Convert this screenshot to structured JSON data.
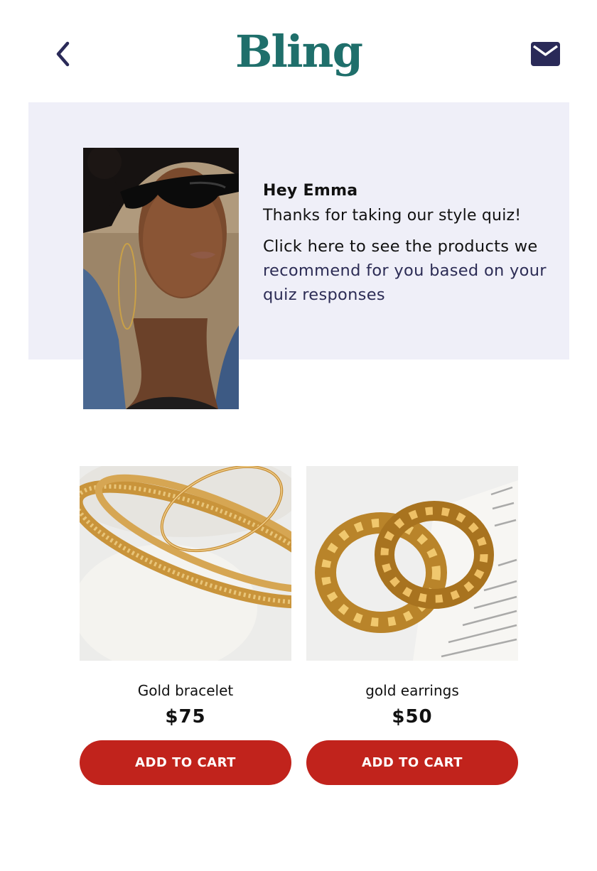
{
  "header": {
    "brand": "Bling",
    "back_icon": "chevron-left-icon",
    "mail_icon": "envelope-icon"
  },
  "hero": {
    "greeting": "Hey Emma",
    "thanks": "Thanks for taking our style quiz!",
    "cta_lead": "Click here to see the products we",
    "cta_link": "recommend for you based on your quiz responses"
  },
  "products": [
    {
      "name": "Gold bracelet",
      "price": "$75",
      "button_label": "ADD TO CART"
    },
    {
      "name": "gold earrings",
      "price": "$50",
      "button_label": "ADD TO CART"
    }
  ],
  "colors": {
    "brand": "#1f6f6b",
    "navy": "#2c2c55",
    "hero_bg": "#efeff8",
    "cta_button": "#c1231c"
  }
}
